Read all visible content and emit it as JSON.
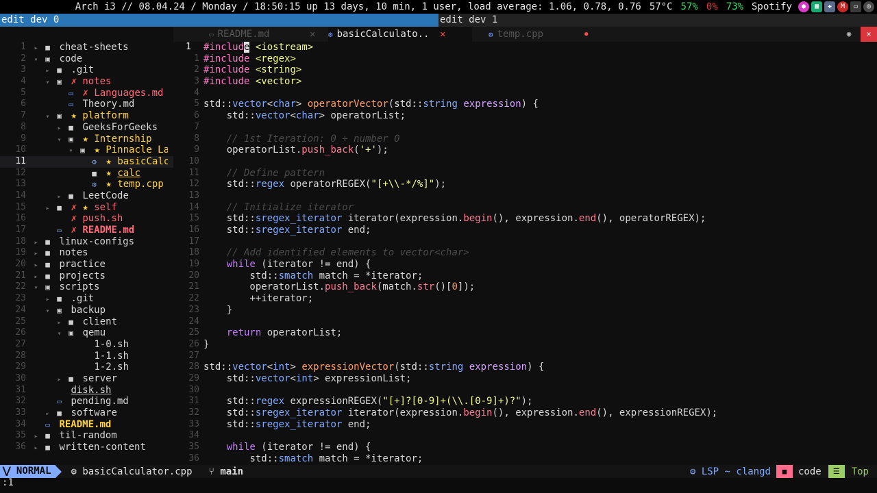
{
  "topbar": {
    "system": "Arch i3 // 08.04.24 / Monday / 18:50:15 up 13 days, 10 min, 1 user, load average: 1.06, 0.78, 0.76",
    "temp": "57°C",
    "cpu": "57%",
    "disk": "0%",
    "mem": "73%",
    "player": "Spotify"
  },
  "titles": {
    "left": "edit dev 0",
    "right": "edit dev 1"
  },
  "tabs": {
    "readme": "README.md",
    "basic": "basicCalculato..",
    "temp": "temp.cpp"
  },
  "tree": [
    {
      "ln": "1",
      "name": "cheat-sheets"
    },
    {
      "ln": "2",
      "name": "code"
    },
    {
      "ln": "3",
      "name": ".git"
    },
    {
      "ln": "4",
      "name": "notes"
    },
    {
      "ln": "5",
      "name": "Languages.md"
    },
    {
      "ln": "6",
      "name": "Theory.md"
    },
    {
      "ln": "7",
      "name": "platform"
    },
    {
      "ln": "8",
      "name": "GeeksForGeeks"
    },
    {
      "ln": "9",
      "name": "Internship"
    },
    {
      "ln": "10",
      "name": "Pinnacle La"
    },
    {
      "ln": "11",
      "name": "basicCalc"
    },
    {
      "ln": "12",
      "name": "calc"
    },
    {
      "ln": "13",
      "name": "temp.cpp"
    },
    {
      "ln": "14",
      "name": "LeetCode"
    },
    {
      "ln": "15",
      "name": "self"
    },
    {
      "ln": "16",
      "name": "push.sh"
    },
    {
      "ln": "17",
      "name": "README.md"
    },
    {
      "ln": "18",
      "name": "linux-configs"
    },
    {
      "ln": "19",
      "name": "notes"
    },
    {
      "ln": "20",
      "name": "practice"
    },
    {
      "ln": "21",
      "name": "projects"
    },
    {
      "ln": "22",
      "name": "scripts"
    },
    {
      "ln": "23",
      "name": ".git"
    },
    {
      "ln": "24",
      "name": "backup"
    },
    {
      "ln": "25",
      "name": "client"
    },
    {
      "ln": "26",
      "name": "qemu"
    },
    {
      "ln": "27",
      "name": "1-0.sh"
    },
    {
      "ln": "28",
      "name": "1-1.sh"
    },
    {
      "ln": "29",
      "name": "1-2.sh"
    },
    {
      "ln": "30",
      "name": "server"
    },
    {
      "ln": "31",
      "name": "disk.sh"
    },
    {
      "ln": "32",
      "name": "pending.md"
    },
    {
      "ln": "33",
      "name": "software"
    },
    {
      "ln": "34",
      "name": "README.md"
    },
    {
      "ln": "35",
      "name": "til-random"
    },
    {
      "ln": "36",
      "name": "written-content"
    }
  ],
  "code_ln": [
    "1",
    "1",
    "2",
    "3",
    "4",
    "5",
    "6",
    "7",
    "8",
    "9",
    "10",
    "11",
    "12",
    "13",
    "14",
    "15",
    "16",
    "17",
    "18",
    "19",
    "20",
    "21",
    "22",
    "23",
    "24",
    "25",
    "26",
    "27",
    "28",
    "29",
    "30",
    "31",
    "32",
    "33",
    "34",
    "35",
    "36"
  ],
  "status": {
    "mode": "NORMAL",
    "file": "basicCalculator.cpp",
    "branch": "main",
    "lsp": "LSP ~ clangd",
    "dir": "code",
    "pos": "Top"
  },
  "cmdline": ":1",
  "colors": {
    "mode": "#82aaff",
    "title_active": "#2a75b5",
    "close": "#d9363e"
  }
}
